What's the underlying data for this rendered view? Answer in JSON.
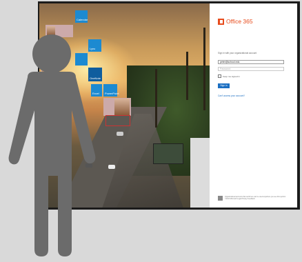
{
  "app": {
    "logo_text": "Office 365",
    "logo_icon": "office-logo-icon",
    "accent": "#e74c1d"
  },
  "tiles": [
    {
      "label": "Calendar"
    },
    {
      "label": "Lync"
    },
    {
      "label": "OneNote"
    },
    {
      "label": "Excel"
    },
    {
      "label": "PowerPoint"
    }
  ],
  "login": {
    "prompt": "Sign in with your organizational account",
    "username_value": "peter@school.edu",
    "password_placeholder": "Password",
    "keep_signed_in": "Keep me signed in",
    "sign_in_label": "Sign in",
    "cant_access": "Can't access your account?",
    "footer_text": "Organizational accounts that work here can be used anywhere you see this symbol. ©2013 Microsoft",
    "footer_links": "Legal  Privacy  Feedback",
    "button_color": "#1c6fc2"
  },
  "overlay": {
    "figure": "person-silhouette",
    "color": "#6b6b6b"
  }
}
